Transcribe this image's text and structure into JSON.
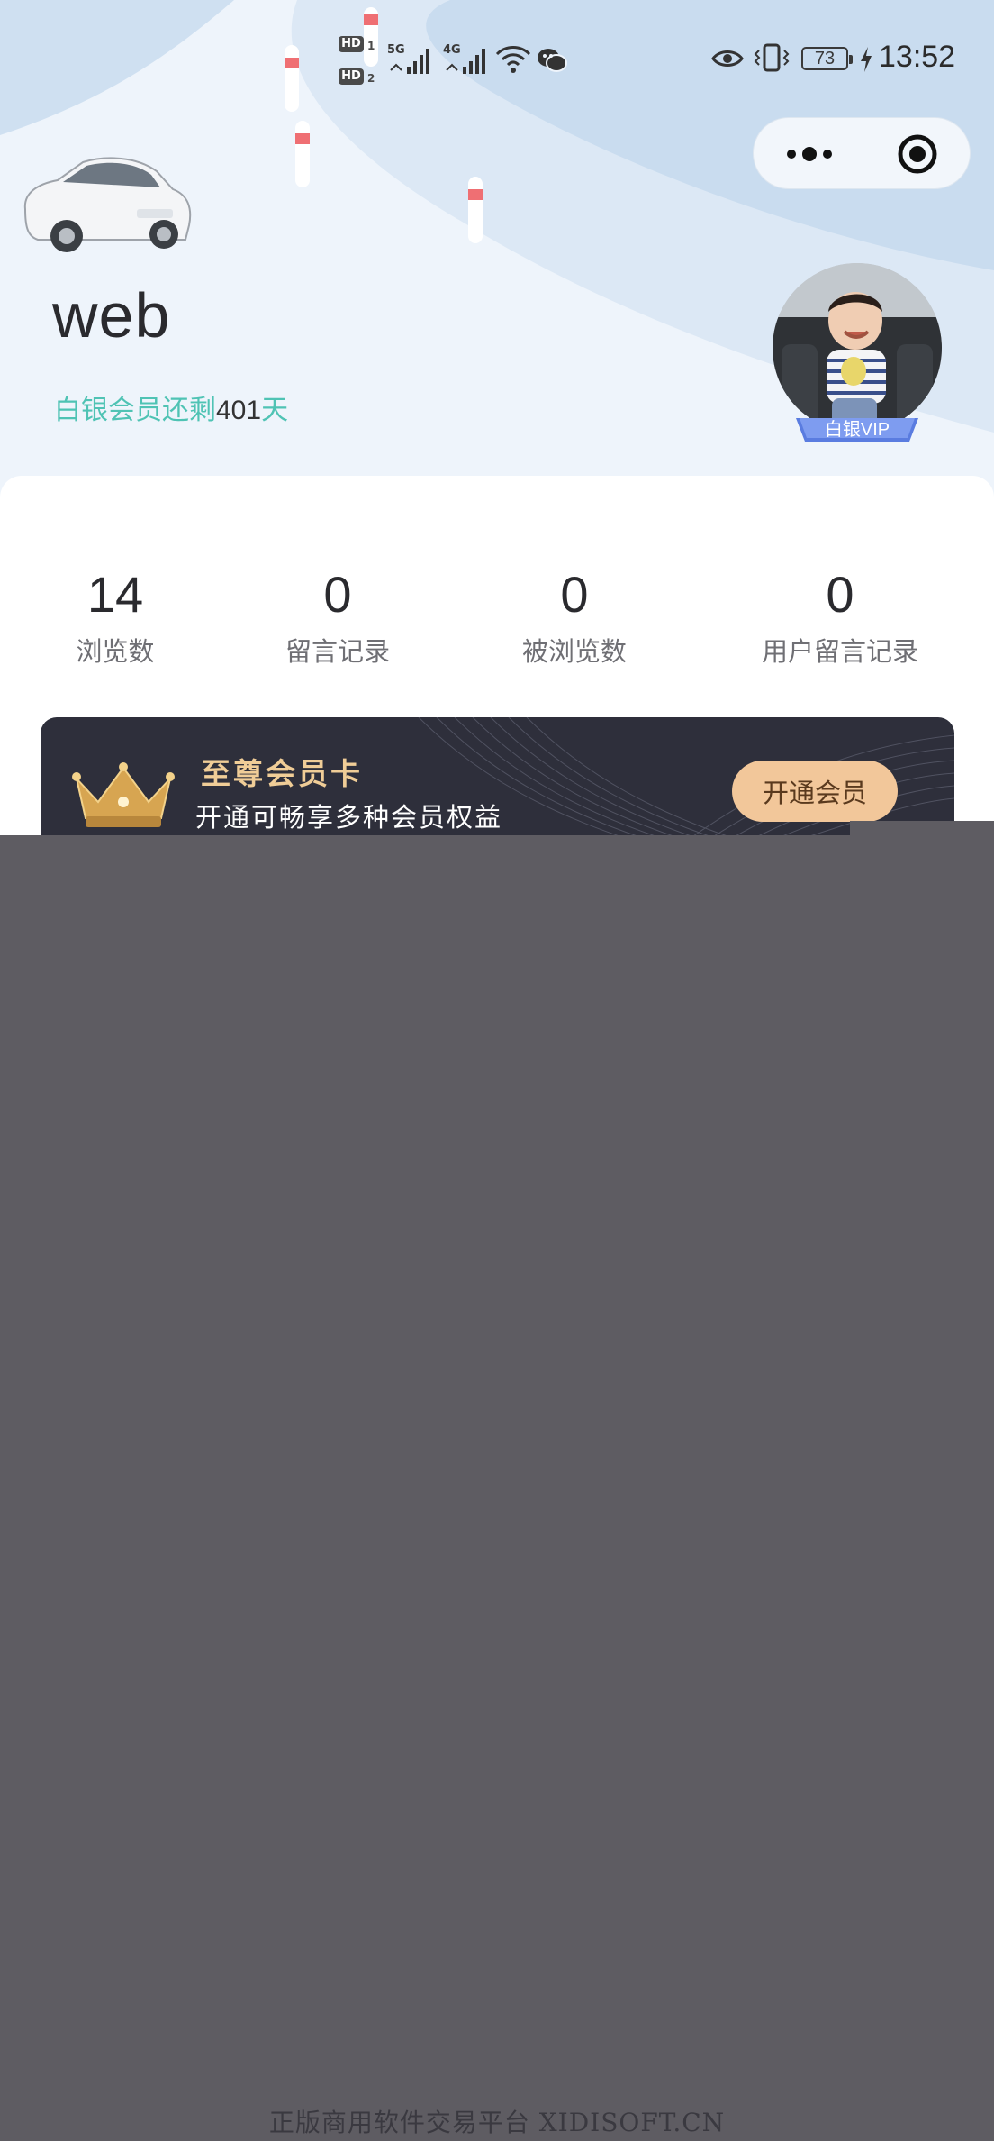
{
  "status_bar": {
    "time": "13:52",
    "battery": "73",
    "hd1": "HD",
    "hd1_sub": "1",
    "hd2": "HD",
    "hd2_sub": "2",
    "signal1_label": "5G",
    "signal2_label": "4G",
    "icons": [
      "eye-icon",
      "vibrate-icon",
      "charging-icon",
      "wifi-icon",
      "wechat-icon"
    ]
  },
  "capsule": {
    "icons": [
      "more-icon",
      "target-icon"
    ]
  },
  "profile": {
    "username": "web",
    "vip_prefix": "白银会员还剩",
    "vip_days": "401",
    "vip_suffix": "天",
    "vip_badge": "白银VIP"
  },
  "stats": [
    {
      "value": "14",
      "label": "浏览数"
    },
    {
      "value": "0",
      "label": "留言记录"
    },
    {
      "value": "0",
      "label": "被浏览数"
    },
    {
      "value": "0",
      "label": "用户留言记录"
    }
  ],
  "member_card": {
    "title": "至尊会员卡",
    "subtitle": "开通可畅享多种会员权益",
    "button": "开通会员"
  },
  "watermark": "正版商用软件交易平台 XIDISOFT.CN",
  "colors": {
    "accent_teal": "#4fc3b4",
    "card_bg": "#2e2f3b",
    "card_title": "#f0cd97",
    "button_bg": "#f2c79a",
    "overlay": "#5e5c62"
  }
}
